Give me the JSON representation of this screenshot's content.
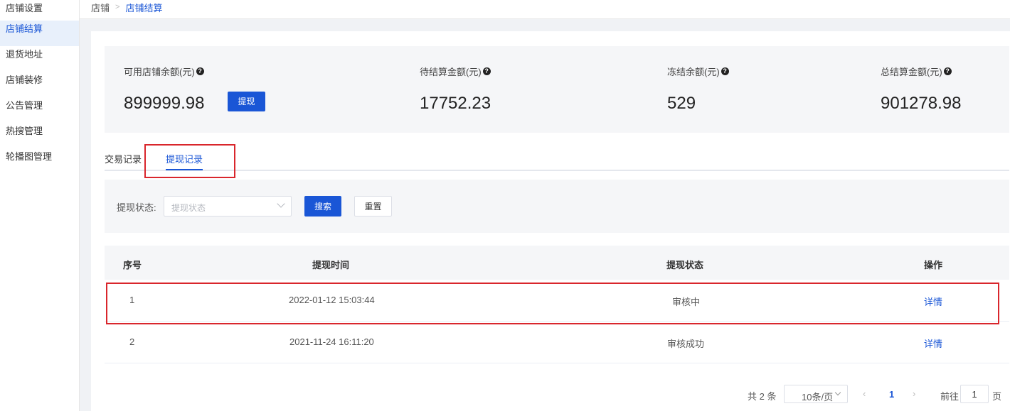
{
  "sidebar": {
    "items": [
      {
        "label": "店铺设置"
      },
      {
        "label": "店铺结算"
      },
      {
        "label": "退货地址"
      },
      {
        "label": "店铺装修"
      },
      {
        "label": "公告管理"
      },
      {
        "label": "热搜管理"
      },
      {
        "label": "轮播图管理"
      }
    ],
    "active_index": 1
  },
  "breadcrumb": {
    "root": "店铺",
    "separator": ">",
    "current": "店铺结算"
  },
  "stats": {
    "available": {
      "label": "可用店铺余额(元)",
      "value": "899999.98"
    },
    "pending": {
      "label": "待结算金额(元)",
      "value": "17752.23"
    },
    "frozen": {
      "label": "冻结余额(元)",
      "value": "529"
    },
    "total": {
      "label": "总结算金额(元)",
      "value": "901278.98"
    },
    "withdraw_button": "提现",
    "help_icon": "question-circle-icon"
  },
  "tabs": {
    "items": [
      {
        "label": "交易记录"
      },
      {
        "label": "提现记录"
      }
    ],
    "active_index": 1
  },
  "filter": {
    "status_label": "提现状态:",
    "status_placeholder": "提现状态",
    "search_button": "搜索",
    "reset_button": "重置"
  },
  "table": {
    "headers": [
      "序号",
      "提现时间",
      "提现状态",
      "操作"
    ],
    "rows": [
      {
        "index": "1",
        "time": "2022-01-12 15:03:44",
        "status": "审核中",
        "action": "详情"
      },
      {
        "index": "2",
        "time": "2021-11-24 16:11:20",
        "status": "审核成功",
        "action": "详情"
      }
    ]
  },
  "pagination": {
    "total": "共 2 条",
    "page_size": "10条/页",
    "prev": "‹",
    "current_page": "1",
    "next": "›",
    "goto_label": "前往",
    "goto_value": "1",
    "goto_suffix": "页"
  },
  "colors": {
    "primary": "#1a56d6",
    "highlight_border": "#d9262c"
  }
}
